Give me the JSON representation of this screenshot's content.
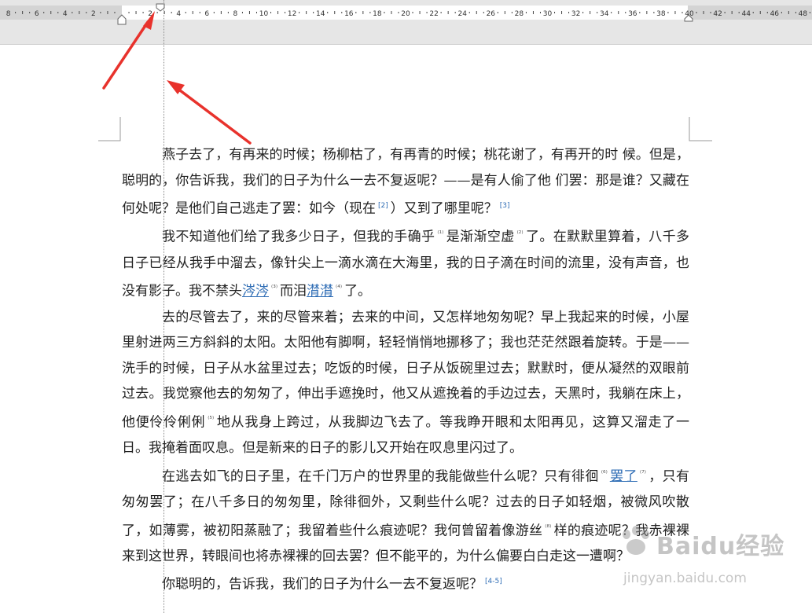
{
  "ruler": {
    "numbers_left": [
      "8",
      "6",
      "4",
      "2"
    ],
    "numbers_right": [
      "2",
      "4",
      "6",
      "8",
      "10",
      "12",
      "14",
      "16",
      "18",
      "20",
      "22",
      "24",
      "26",
      "28",
      "30",
      "32",
      "34",
      "36",
      "38",
      "40",
      "42",
      "44",
      "46",
      "48"
    ]
  },
  "document": {
    "paragraphs": [
      {
        "segments": [
          {
            "text": "燕子去了，有再来的时候；杨柳枯了，有再青的时候；桃花谢了，有再开的时 候。但是，聪明的，你告诉我，我们的日子为什么一去不复返呢？——是有人偷了他 们罢：那是谁？又藏在何处呢？是他们自己逃走了罢：如今（现在"
          },
          {
            "fref": "[2]"
          },
          {
            "text": "）又到了哪里呢？"
          },
          {
            "fref": "[3]"
          }
        ]
      },
      {
        "segments": [
          {
            "text": "我不知道他们给了我多少日子，但我的手确乎"
          },
          {
            "ref": "⁽¹⁾"
          },
          {
            "text": "是渐渐空虚"
          },
          {
            "ref": "⁽²⁾"
          },
          {
            "text": "了。在默默里算着，八千多日子已经从我手中溜去，像针尖上一滴水滴在大海里，我的日子滴在时间的流里，没有声音，也没有影子。我不禁头"
          },
          {
            "link": "涔涔"
          },
          {
            "ref": "⁽³⁾"
          },
          {
            "text": "而泪"
          },
          {
            "link": "潸潸"
          },
          {
            "ref": "⁽⁴⁾"
          },
          {
            "text": "了。"
          }
        ]
      },
      {
        "segments": [
          {
            "text": "去的尽管去了，来的尽管来着；去来的中间，又怎样地匆匆呢？早上我起来的时候，小屋里射进两三方斜斜的太阳。太阳他有脚啊，轻轻悄悄地挪移了；我也茫茫然跟着旋转。于是——洗手的时候，日子从水盆里过去；吃饭的时候，日子从饭碗里过去；默默时，便从凝然的双眼前过去。我觉察他去的匆匆了，伸出手遮挽时，他又从遮挽着的手边过去，天黑时，我躺在床上，他便伶伶俐俐"
          },
          {
            "ref": "⁽⁵⁾"
          },
          {
            "text": "地从我身上跨过，从我脚边飞去了。等我睁开眼和太阳再见，这算又溜走了一日。我掩着面叹息。但是新来的日子的影儿又开始在叹息里闪过了。"
          }
        ]
      },
      {
        "segments": [
          {
            "text": "在逃去如飞的日子里，在千门万户的世界里的我能做些什么呢？只有徘徊"
          },
          {
            "ref": "⁽⁶⁾"
          },
          {
            "link": "罢了"
          },
          {
            "ref": "⁽⁷⁾"
          },
          {
            "text": "，只有匆匆罢了；在八千多日的匆匆里，除徘徊外，又剩些什么呢？过去的日子如轻烟，被微风吹散了，如薄雾，被初阳蒸融了；我留着些什么痕迹呢？我何曾留着像游丝"
          },
          {
            "ref": "⁽⁸⁾"
          },
          {
            "text": "样的痕迹呢？我赤裸裸来到这世界，转眼间也将赤裸裸的回去罢？但不能平的，为什么偏要白白走这一遭啊？"
          }
        ]
      },
      {
        "segments": [
          {
            "text": "你聪明的，告诉我，我们的日子为什么一去不复返呢？"
          },
          {
            "fref": "[4-5]"
          }
        ]
      }
    ]
  },
  "watermark": {
    "brand": "Baidu经验",
    "url": "jingyan.baidu.com"
  },
  "colors": {
    "arrow": "#e8322c",
    "link": "#2f6db5"
  }
}
